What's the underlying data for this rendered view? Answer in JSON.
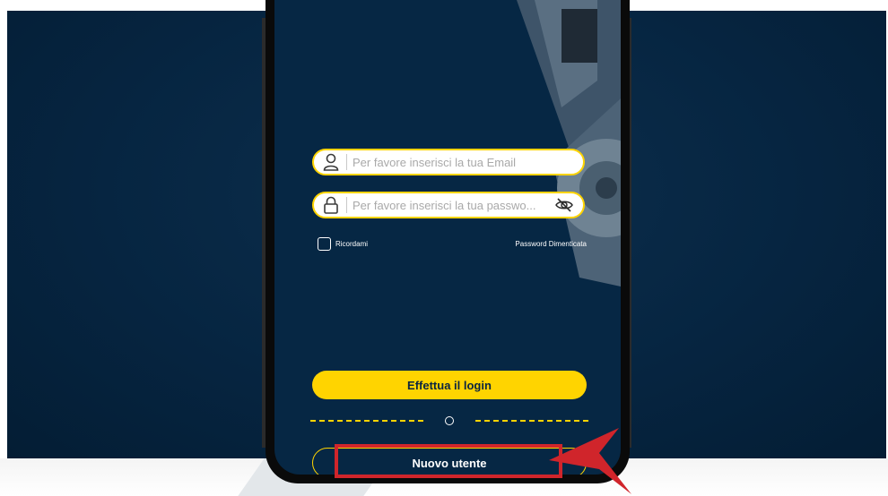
{
  "login": {
    "email_placeholder": "Per favore inserisci la tua Email",
    "password_placeholder": "Per favore inserisci la tua passwo...",
    "remember_label": "Ricordami",
    "forgot_label": "Password Dimenticata",
    "login_button": "Effettua il login",
    "new_user_button": "Nuovo utente"
  },
  "icons": {
    "email": "user-icon",
    "password": "lock-icon",
    "visibility": "eye-slash-icon"
  },
  "colors": {
    "accent": "#ffd400",
    "background": "#062744",
    "highlight": "#d0252b"
  }
}
